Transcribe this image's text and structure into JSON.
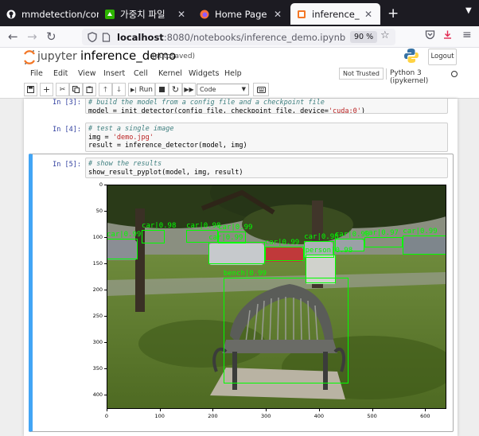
{
  "browser": {
    "tabs": [
      {
        "label": "mmdetection/confi",
        "icon": "github-icon",
        "active": false
      },
      {
        "label": "가중치 파일",
        "icon": "green-app-icon",
        "active": false
      },
      {
        "label": "Home Page - Select",
        "icon": "firefox-icon",
        "active": false
      },
      {
        "label": "inference_demo - J",
        "icon": "jupyter-tab-icon",
        "active": true
      }
    ],
    "url_host": "localhost",
    "url_path": ":8080/notebooks/inference_demo.ipynb",
    "zoom": "90 %"
  },
  "jupyter": {
    "logo_text": "jupyter",
    "notebook_title": "inference_demo",
    "save_status": "(autosaved)",
    "logout_label": "Logout",
    "menu": [
      "File",
      "Edit",
      "View",
      "Insert",
      "Cell",
      "Kernel",
      "Widgets",
      "Help"
    ],
    "trust_label": "Not Trusted",
    "kernel_name": "Python 3 (ipykernel)",
    "toolbar": {
      "run_label": "Run",
      "cell_type": "Code"
    }
  },
  "cells": [
    {
      "prompt": "In [3]:",
      "lines": [
        {
          "type": "comment",
          "text": "# build the model from a config file and a checkpoint file"
        },
        {
          "type": "code",
          "pre": "model = init_detector(config_file, checkpoint_file, device=",
          "str": "'cuda:0'",
          "post": ")"
        }
      ]
    },
    {
      "prompt": "In [4]:",
      "lines": [
        {
          "type": "comment",
          "text": "# test a single image"
        },
        {
          "type": "code",
          "pre": "img = ",
          "str": "'demo.jpg'",
          "post": ""
        },
        {
          "type": "code",
          "pre": "result = inference_detector(model, img)",
          "str": "",
          "post": ""
        }
      ]
    },
    {
      "prompt": "In [5]:",
      "lines": [
        {
          "type": "comment",
          "text": "# show the results"
        },
        {
          "type": "code",
          "pre": "show_result_pyplot(model, img, result)",
          "str": "",
          "post": ""
        }
      ]
    }
  ],
  "plot": {
    "y_ticks": [
      "0",
      "50",
      "100",
      "150",
      "200",
      "250",
      "300",
      "350",
      "400"
    ],
    "x_ticks": [
      "0",
      "100",
      "200",
      "300",
      "400",
      "500",
      "600"
    ],
    "image_width": 640,
    "image_height": 427,
    "box_color": "#00ff00",
    "detections": [
      {
        "label": "bench|0.99",
        "x0": 220,
        "y0": 177,
        "x1": 456,
        "y1": 378
      },
      {
        "label": "car|0.99",
        "x0": 0,
        "y0": 103,
        "x1": 58,
        "y1": 143
      },
      {
        "label": "car|0.99",
        "x0": 192,
        "y0": 109,
        "x1": 298,
        "y1": 151
      },
      {
        "label": "car|0.99",
        "x0": 298,
        "y0": 118,
        "x1": 372,
        "y1": 146
      },
      {
        "label": "car|0.98",
        "x0": 430,
        "y0": 103,
        "x1": 485,
        "y1": 127
      },
      {
        "label": "car|0.99",
        "x0": 558,
        "y0": 97,
        "x1": 640,
        "y1": 134
      },
      {
        "label": "car|0.98",
        "x0": 372,
        "y0": 107,
        "x1": 428,
        "y1": 140
      },
      {
        "label": "person|0.98",
        "x0": 374,
        "y0": 134,
        "x1": 432,
        "y1": 188
      },
      {
        "label": "car|0.98",
        "x0": 66,
        "y0": 87,
        "x1": 110,
        "y1": 112
      },
      {
        "label": "car|0.98",
        "x0": 150,
        "y0": 86,
        "x1": 210,
        "y1": 110
      },
      {
        "label": "car|0.99",
        "x0": 210,
        "y0": 90,
        "x1": 262,
        "y1": 112
      },
      {
        "label": "car|0.97",
        "x0": 485,
        "y0": 100,
        "x1": 558,
        "y1": 120
      }
    ]
  }
}
